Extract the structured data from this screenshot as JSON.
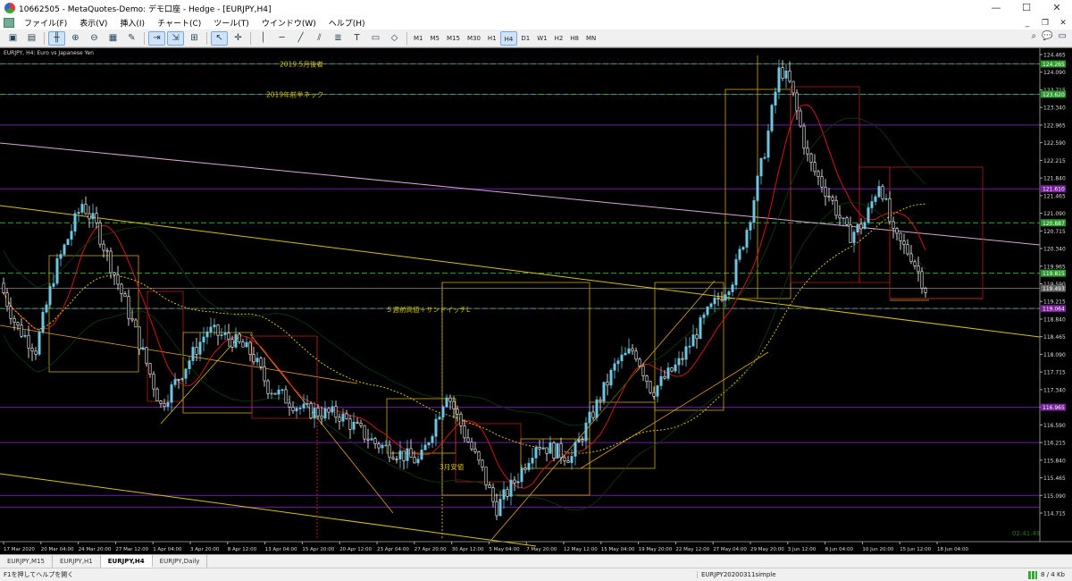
{
  "window": {
    "title": "10662505 - MetaQuotes-Demo: デモ口座 - Hedge - [EURJPY,H4]",
    "controls": {
      "minimize": "—",
      "maximize": "☐",
      "close": "✕"
    }
  },
  "menu": {
    "items": [
      "ファイル(F)",
      "表示(V)",
      "挿入(I)",
      "チャート(C)",
      "ツール(T)",
      "ウインドウ(W)",
      "ヘルプ(H)"
    ],
    "mdi": {
      "minimize": "_",
      "restore": "❐",
      "close": "✕"
    }
  },
  "toolbar": {
    "timeframes": [
      "M1",
      "M5",
      "M15",
      "M30",
      "H1",
      "H4",
      "D1",
      "W1",
      "H2",
      "H8",
      "MN"
    ],
    "active_timeframe": "H4"
  },
  "chart": {
    "header": "EURJPY, H4:  Euro vs Japanese Yen",
    "background": "#000000",
    "bull_color": "#6ec6e0",
    "bear_color": "#ffffff",
    "annotations": {
      "may_high": "2019.5月後者",
      "h1_neck": "2019年前半ネック",
      "five_week": "５週前高値＋サンドイッチL",
      "march_low": "3月安値"
    },
    "price_axis": [
      "124.465",
      "124.090",
      "123.715",
      "123.340",
      "122.965",
      "122.590",
      "122.215",
      "121.840",
      "121.465",
      "121.090",
      "120.715",
      "120.340",
      "119.965",
      "119.590",
      "119.215",
      "118.840",
      "118.465",
      "118.090",
      "117.715",
      "117.340",
      "116.965",
      "116.590",
      "116.215",
      "115.840",
      "115.465",
      "115.090",
      "114.715"
    ],
    "price_labels": [
      {
        "text": "124.265",
        "color": "#2a9a2a"
      },
      {
        "text": "123.620",
        "color": "#2a9a2a"
      },
      {
        "text": "120.887",
        "color": "#2a9a2a"
      },
      {
        "text": "119.815",
        "color": "#2a9a2a"
      },
      {
        "text": "119.493",
        "color": "#606060"
      },
      {
        "text": "121.610",
        "color": "#7a1f9a"
      },
      {
        "text": "119.064",
        "color": "#7a1f9a"
      },
      {
        "text": "116.965",
        "color": "#7a1f9a"
      }
    ],
    "time_axis": [
      "17 Mar 2020",
      "20 Mar 04:00",
      "24 Mar 20:00",
      "27 Mar 12:00",
      "1 Apr 04:00",
      "3 Apr 20:00",
      "8 Apr 12:00",
      "13 Apr 04:00",
      "15 Apr 20:00",
      "20 Apr 12:00",
      "23 Apr 04:00",
      "27 Apr 20:00",
      "30 Apr 12:00",
      "5 May 04:00",
      "7 May 20:00",
      "12 May 12:00",
      "15 May 04:00",
      "19 May 20:00",
      "22 May 12:00",
      "27 May 04:00",
      "29 May 20:00",
      "3 Jun 12:00",
      "8 Jun 04:00",
      "10 Jun 20:00",
      "15 Jun 12:00",
      "18 Jun 04:00"
    ],
    "countdown": "02:41:49"
  },
  "tabs": {
    "items": [
      "EURJPY,M15",
      "EURJPY,H1",
      "EURJPY,H4",
      "EURJPY,Daily"
    ],
    "active": "EURJPY,H4"
  },
  "status": {
    "help": "F1を押してヘルプを開く",
    "profile": "EURJPY20200311simple",
    "traffic": "8 / 4 Kb"
  }
}
